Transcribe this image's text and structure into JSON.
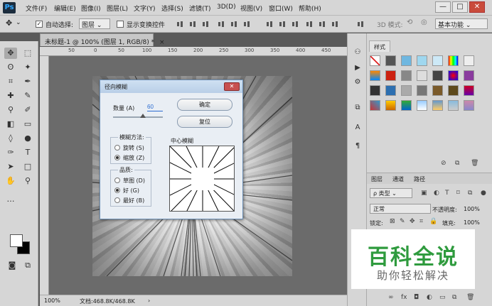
{
  "app": {
    "logo": "Ps"
  },
  "menu": [
    "文件(F)",
    "编辑(E)",
    "图像(I)",
    "图层(L)",
    "文字(Y)",
    "选择(S)",
    "滤镜(T)",
    "3D(D)",
    "视图(V)",
    "窗口(W)",
    "帮助(H)"
  ],
  "window_controls": {
    "minimize": "—",
    "maximize": "□",
    "close": "✕"
  },
  "options": {
    "auto_select_label": "自动选择:",
    "auto_select_value": "图层",
    "show_transform_label": "显示变换控件",
    "mode_3d": "3D 模式:",
    "workspace": "基本功能"
  },
  "document": {
    "tab_title": "未标题-1 @ 100% (图层 1, RGB/8) *",
    "tab_close": "×",
    "ruler_ticks": [
      "50",
      "0",
      "50",
      "100",
      "150",
      "200",
      "250",
      "300",
      "350",
      "400",
      "450"
    ],
    "zoom": "100%",
    "doc_size": "文档:468.8K/468.8K"
  },
  "dialog": {
    "title": "径向模糊",
    "amount_label": "数量 (A)",
    "amount_value": "60",
    "ok": "确定",
    "reset": "复位",
    "method_title": "模糊方法:",
    "method_spin": "旋转 (S)",
    "method_zoom": "缩放 (Z)",
    "quality_title": "品质:",
    "quality_draft": "草图 (D)",
    "quality_good": "好 (G)",
    "quality_best": "最好 (B)",
    "center_label": "中心模糊"
  },
  "styles_panel": {
    "tab": "样式"
  },
  "layers_panel": {
    "tabs": [
      "图层",
      "通道",
      "路径"
    ],
    "filter_kind": "ρ 类型",
    "blend_mode": "正常",
    "opacity_label": "不透明度:",
    "opacity_value": "100%",
    "lock_label": "锁定:",
    "fill_label": "填充:",
    "fill_value": "100%"
  },
  "watermark": {
    "title": "百科全说",
    "subtitle": "助你轻松解决"
  }
}
